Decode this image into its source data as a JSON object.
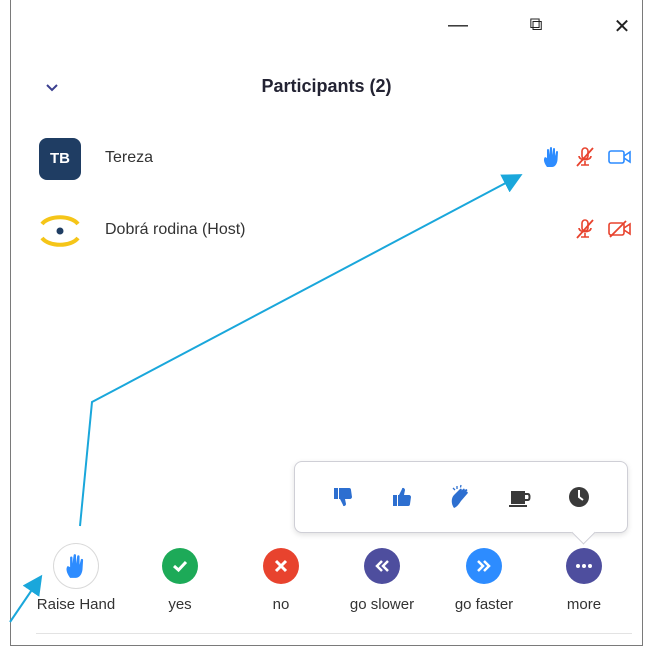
{
  "window_controls": {
    "minimize": "—",
    "maximize": "⧉",
    "close": "✕"
  },
  "panel": {
    "title": "Participants (2)"
  },
  "participants": [
    {
      "initials": "TB",
      "name": "Tereza",
      "hand_raised": true,
      "muted": true,
      "video_on": true
    },
    {
      "initials": "",
      "name": "Dobrá rodina (Host)",
      "hand_raised": false,
      "muted": true,
      "video_on": false
    }
  ],
  "reactions": [
    "thumbs-down",
    "thumbs-up",
    "clap",
    "coffee",
    "clock"
  ],
  "actions": [
    {
      "label": "Raise Hand",
      "color": "#2D8CFF"
    },
    {
      "label": "yes",
      "color": "#1DAA58"
    },
    {
      "label": "no",
      "color": "#E8432E"
    },
    {
      "label": "go slower",
      "color": "#4E4E9E"
    },
    {
      "label": "go faster",
      "color": "#2D8CFF"
    },
    {
      "label": "more",
      "color": "#4E4E9E"
    }
  ],
  "colors": {
    "accent": "#2D8CFF",
    "muted_red": "#E8432E",
    "avatar_navy": "#1F3D63",
    "annotation": "#1AA7DB"
  }
}
